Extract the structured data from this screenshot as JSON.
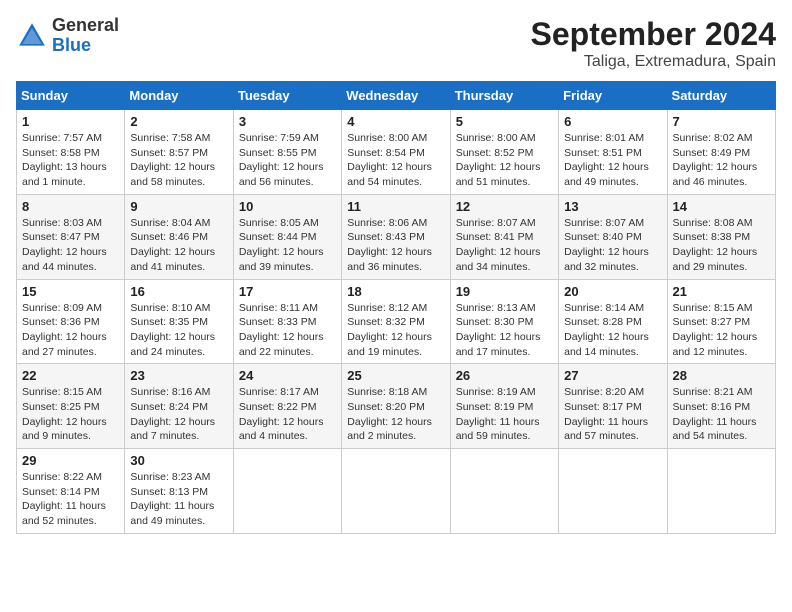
{
  "header": {
    "logo_general": "General",
    "logo_blue": "Blue",
    "month_year": "September 2024",
    "location": "Taliga, Extremadura, Spain"
  },
  "weekdays": [
    "Sunday",
    "Monday",
    "Tuesday",
    "Wednesday",
    "Thursday",
    "Friday",
    "Saturday"
  ],
  "weeks": [
    [
      {
        "day": "1",
        "sunrise": "Sunrise: 7:57 AM",
        "sunset": "Sunset: 8:58 PM",
        "daylight": "Daylight: 13 hours and 1 minute."
      },
      {
        "day": "2",
        "sunrise": "Sunrise: 7:58 AM",
        "sunset": "Sunset: 8:57 PM",
        "daylight": "Daylight: 12 hours and 58 minutes."
      },
      {
        "day": "3",
        "sunrise": "Sunrise: 7:59 AM",
        "sunset": "Sunset: 8:55 PM",
        "daylight": "Daylight: 12 hours and 56 minutes."
      },
      {
        "day": "4",
        "sunrise": "Sunrise: 8:00 AM",
        "sunset": "Sunset: 8:54 PM",
        "daylight": "Daylight: 12 hours and 54 minutes."
      },
      {
        "day": "5",
        "sunrise": "Sunrise: 8:00 AM",
        "sunset": "Sunset: 8:52 PM",
        "daylight": "Daylight: 12 hours and 51 minutes."
      },
      {
        "day": "6",
        "sunrise": "Sunrise: 8:01 AM",
        "sunset": "Sunset: 8:51 PM",
        "daylight": "Daylight: 12 hours and 49 minutes."
      },
      {
        "day": "7",
        "sunrise": "Sunrise: 8:02 AM",
        "sunset": "Sunset: 8:49 PM",
        "daylight": "Daylight: 12 hours and 46 minutes."
      }
    ],
    [
      {
        "day": "8",
        "sunrise": "Sunrise: 8:03 AM",
        "sunset": "Sunset: 8:47 PM",
        "daylight": "Daylight: 12 hours and 44 minutes."
      },
      {
        "day": "9",
        "sunrise": "Sunrise: 8:04 AM",
        "sunset": "Sunset: 8:46 PM",
        "daylight": "Daylight: 12 hours and 41 minutes."
      },
      {
        "day": "10",
        "sunrise": "Sunrise: 8:05 AM",
        "sunset": "Sunset: 8:44 PM",
        "daylight": "Daylight: 12 hours and 39 minutes."
      },
      {
        "day": "11",
        "sunrise": "Sunrise: 8:06 AM",
        "sunset": "Sunset: 8:43 PM",
        "daylight": "Daylight: 12 hours and 36 minutes."
      },
      {
        "day": "12",
        "sunrise": "Sunrise: 8:07 AM",
        "sunset": "Sunset: 8:41 PM",
        "daylight": "Daylight: 12 hours and 34 minutes."
      },
      {
        "day": "13",
        "sunrise": "Sunrise: 8:07 AM",
        "sunset": "Sunset: 8:40 PM",
        "daylight": "Daylight: 12 hours and 32 minutes."
      },
      {
        "day": "14",
        "sunrise": "Sunrise: 8:08 AM",
        "sunset": "Sunset: 8:38 PM",
        "daylight": "Daylight: 12 hours and 29 minutes."
      }
    ],
    [
      {
        "day": "15",
        "sunrise": "Sunrise: 8:09 AM",
        "sunset": "Sunset: 8:36 PM",
        "daylight": "Daylight: 12 hours and 27 minutes."
      },
      {
        "day": "16",
        "sunrise": "Sunrise: 8:10 AM",
        "sunset": "Sunset: 8:35 PM",
        "daylight": "Daylight: 12 hours and 24 minutes."
      },
      {
        "day": "17",
        "sunrise": "Sunrise: 8:11 AM",
        "sunset": "Sunset: 8:33 PM",
        "daylight": "Daylight: 12 hours and 22 minutes."
      },
      {
        "day": "18",
        "sunrise": "Sunrise: 8:12 AM",
        "sunset": "Sunset: 8:32 PM",
        "daylight": "Daylight: 12 hours and 19 minutes."
      },
      {
        "day": "19",
        "sunrise": "Sunrise: 8:13 AM",
        "sunset": "Sunset: 8:30 PM",
        "daylight": "Daylight: 12 hours and 17 minutes."
      },
      {
        "day": "20",
        "sunrise": "Sunrise: 8:14 AM",
        "sunset": "Sunset: 8:28 PM",
        "daylight": "Daylight: 12 hours and 14 minutes."
      },
      {
        "day": "21",
        "sunrise": "Sunrise: 8:15 AM",
        "sunset": "Sunset: 8:27 PM",
        "daylight": "Daylight: 12 hours and 12 minutes."
      }
    ],
    [
      {
        "day": "22",
        "sunrise": "Sunrise: 8:15 AM",
        "sunset": "Sunset: 8:25 PM",
        "daylight": "Daylight: 12 hours and 9 minutes."
      },
      {
        "day": "23",
        "sunrise": "Sunrise: 8:16 AM",
        "sunset": "Sunset: 8:24 PM",
        "daylight": "Daylight: 12 hours and 7 minutes."
      },
      {
        "day": "24",
        "sunrise": "Sunrise: 8:17 AM",
        "sunset": "Sunset: 8:22 PM",
        "daylight": "Daylight: 12 hours and 4 minutes."
      },
      {
        "day": "25",
        "sunrise": "Sunrise: 8:18 AM",
        "sunset": "Sunset: 8:20 PM",
        "daylight": "Daylight: 12 hours and 2 minutes."
      },
      {
        "day": "26",
        "sunrise": "Sunrise: 8:19 AM",
        "sunset": "Sunset: 8:19 PM",
        "daylight": "Daylight: 11 hours and 59 minutes."
      },
      {
        "day": "27",
        "sunrise": "Sunrise: 8:20 AM",
        "sunset": "Sunset: 8:17 PM",
        "daylight": "Daylight: 11 hours and 57 minutes."
      },
      {
        "day": "28",
        "sunrise": "Sunrise: 8:21 AM",
        "sunset": "Sunset: 8:16 PM",
        "daylight": "Daylight: 11 hours and 54 minutes."
      }
    ],
    [
      {
        "day": "29",
        "sunrise": "Sunrise: 8:22 AM",
        "sunset": "Sunset: 8:14 PM",
        "daylight": "Daylight: 11 hours and 52 minutes."
      },
      {
        "day": "30",
        "sunrise": "Sunrise: 8:23 AM",
        "sunset": "Sunset: 8:13 PM",
        "daylight": "Daylight: 11 hours and 49 minutes."
      },
      null,
      null,
      null,
      null,
      null
    ]
  ]
}
